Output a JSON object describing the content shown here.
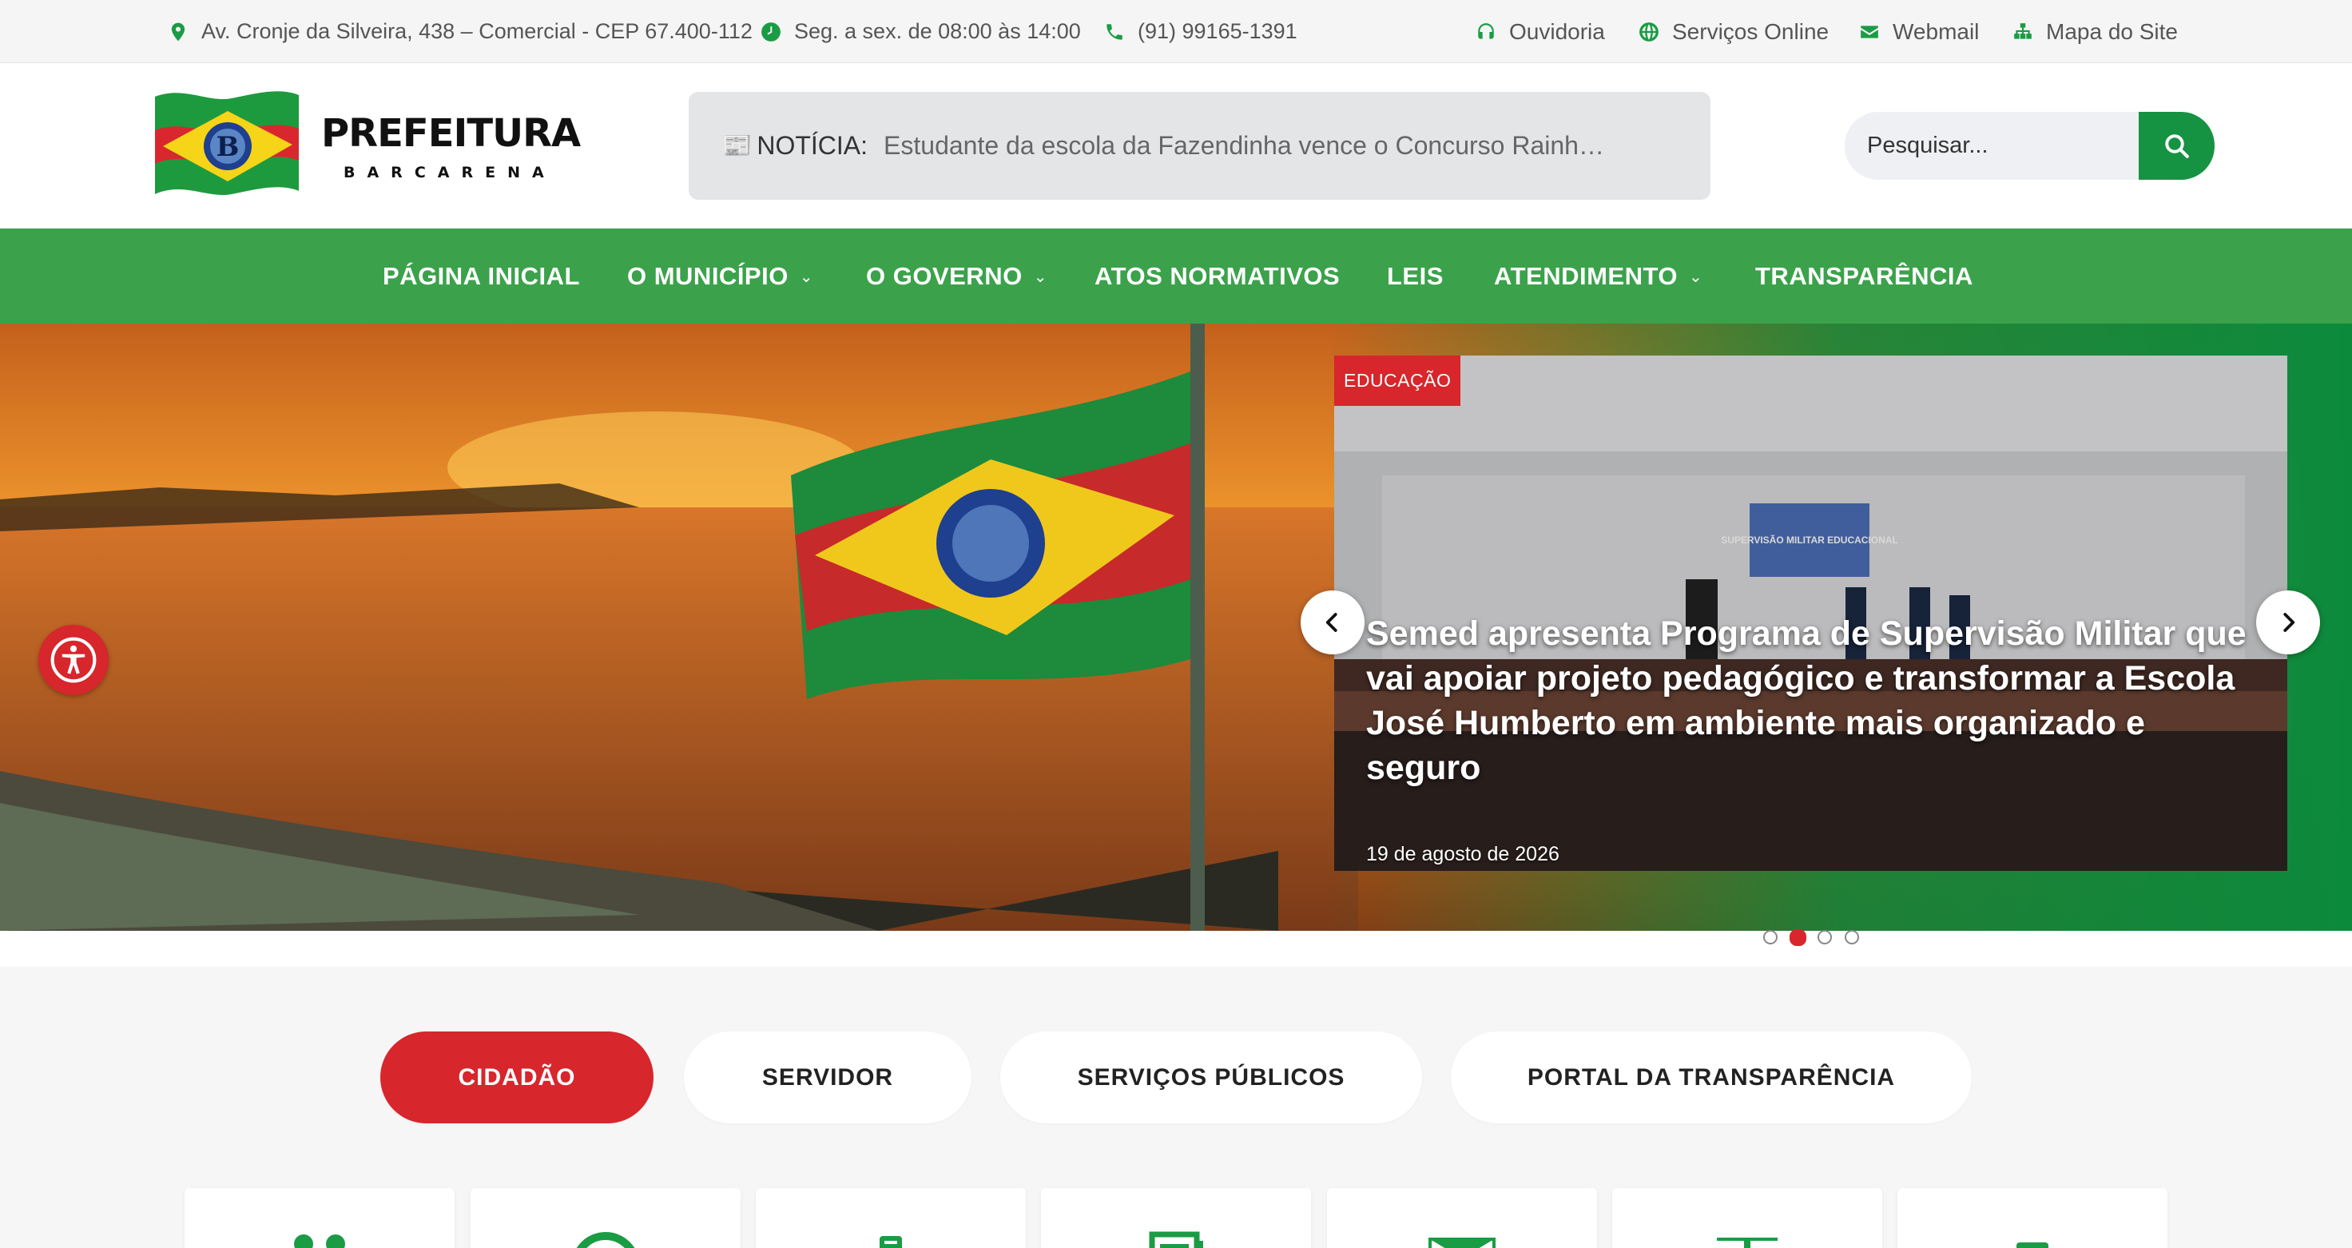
{
  "topbar": {
    "address": "Av. Cronje da Silveira, 438 – Comercial - CEP 67.400-112",
    "hours": "Seg. a sex. de 08:00 às 14:00",
    "phone": "(91) 99165-1391",
    "links": {
      "ouvidoria": "Ouvidoria",
      "servicos": "Serviços Online",
      "webmail": "Webmail",
      "mapa": "Mapa do Site"
    }
  },
  "logo": {
    "title": "PREFEITURA",
    "subtitle": "BARCARENA"
  },
  "ticker": {
    "label": "NOTÍCIA:",
    "text": "Estudante da escola da Fazendinha vence o Concurso Rainh…"
  },
  "search": {
    "placeholder": "Pesquisar..."
  },
  "nav": {
    "items": [
      "PÁGINA INICIAL",
      "O MUNICÍPIO",
      "O GOVERNO",
      "ATOS NORMATIVOS",
      "LEIS",
      "ATENDIMENTO",
      "TRANSPARÊNCIA"
    ]
  },
  "slide": {
    "badge": "EDUCAÇÃO",
    "title": "Semed apresenta Programa de Supervisão Militar que vai apoiar projeto pedagógico e transformar a Escola José Humberto em ambiente mais organizado e seguro",
    "date": "19 de agosto de 2026",
    "screen_text": "SUPERVISÃO MILITAR EDUCACIONAL",
    "dots_total": 4,
    "dots_active": 2
  },
  "tabs": [
    "CIDADÃO",
    "SERVIDOR",
    "SERVIÇOS PÚBLICOS",
    "PORTAL DA TRANSPARÊNCIA"
  ],
  "colors": {
    "green": "#3ba24b",
    "dark_green": "#159342",
    "red": "#d7262c",
    "icon_green": "#1a9c44"
  },
  "icons": {
    "address": "map-pin-icon",
    "hours": "clock-icon",
    "phone": "phone-icon",
    "ouvidoria": "headset-icon",
    "servicos": "globe-icon",
    "webmail": "envelope-icon",
    "mapa": "sitemap-icon",
    "search": "search-icon",
    "accessibility": "accessibility-icon"
  }
}
